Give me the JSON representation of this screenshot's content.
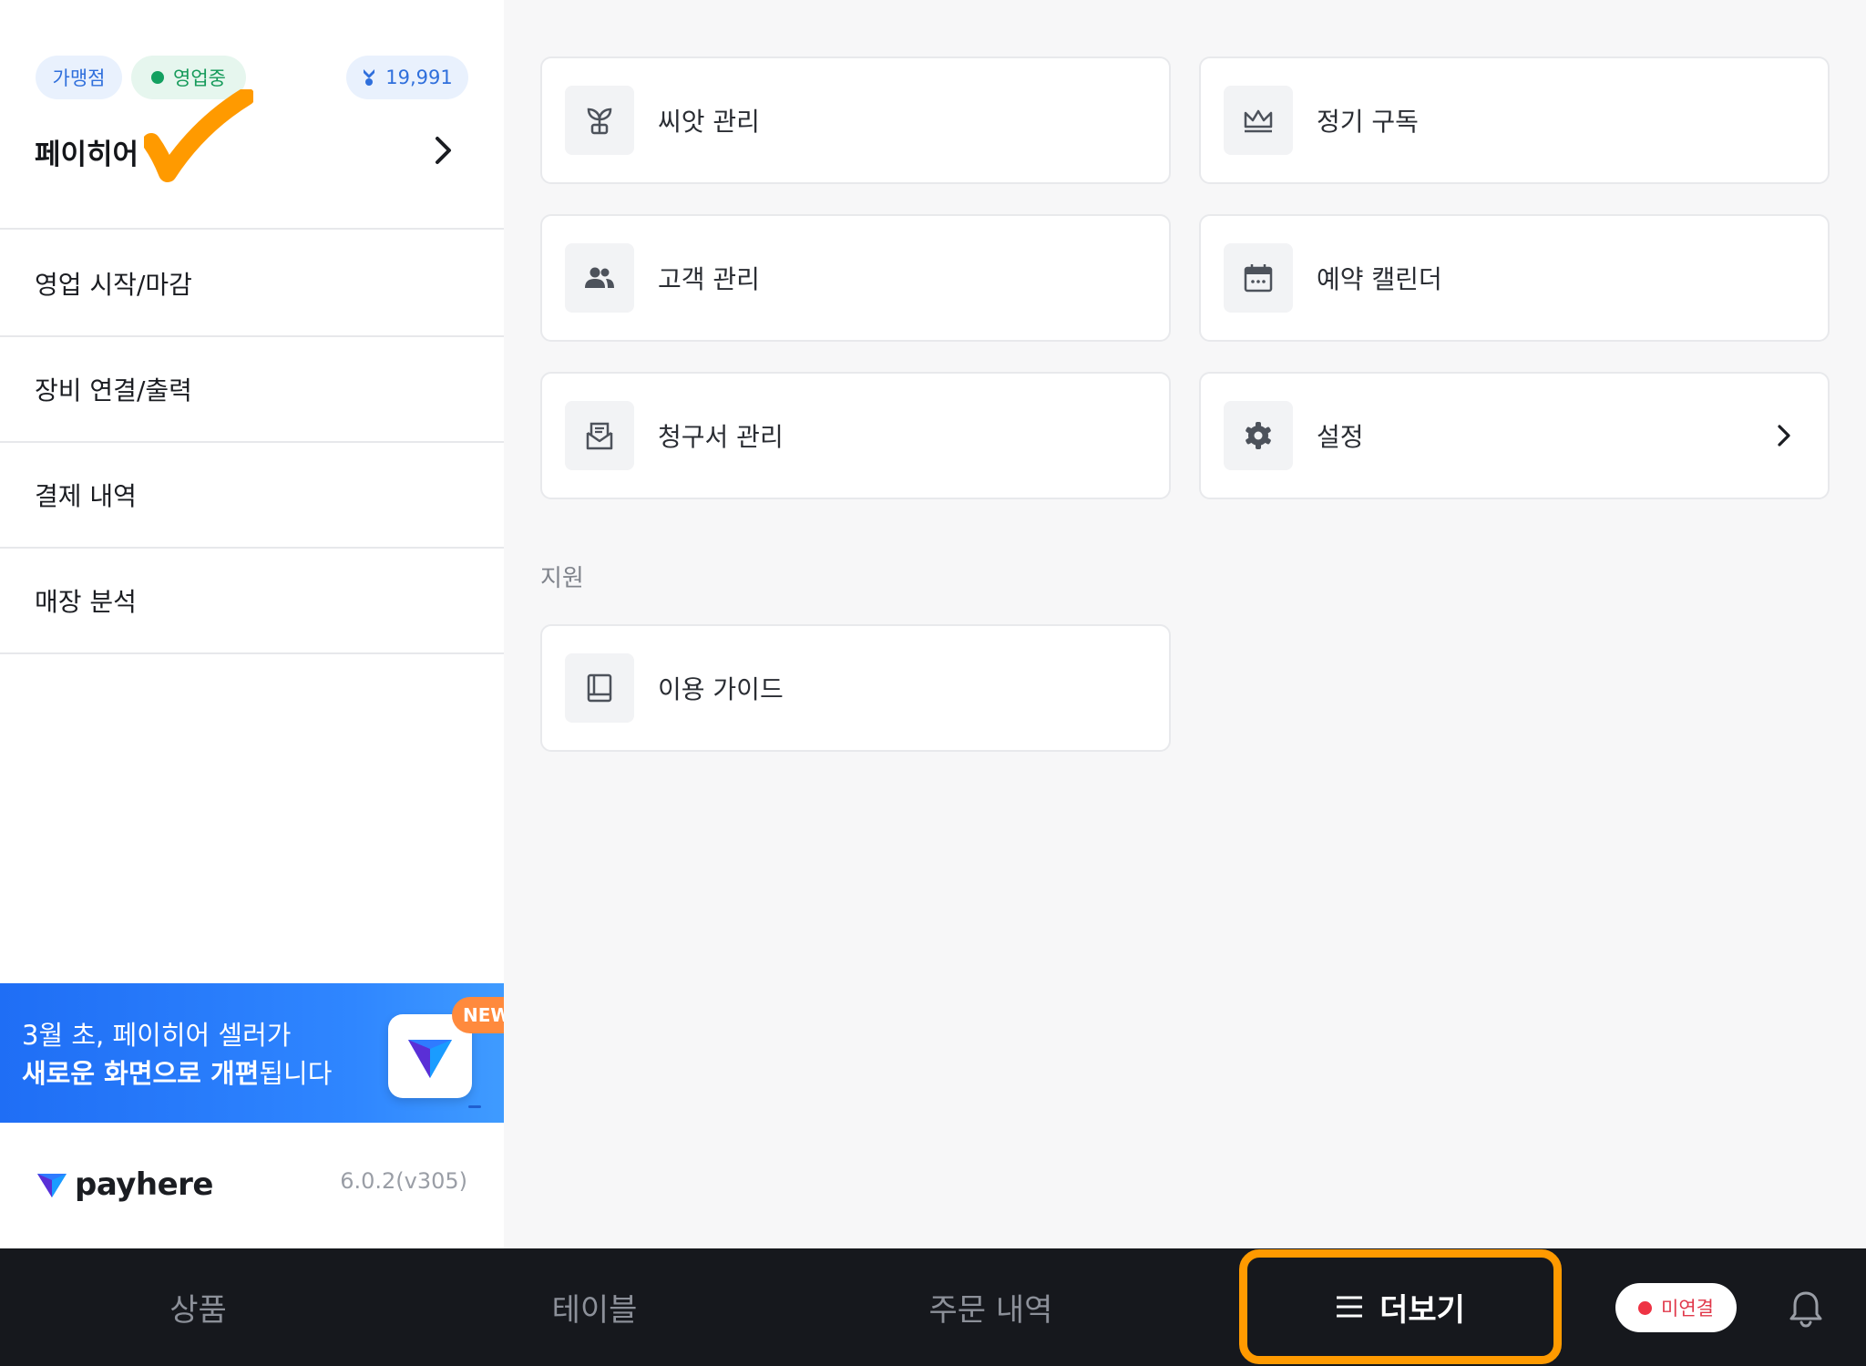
{
  "sidebar": {
    "badges": {
      "store_type": "가맹점",
      "status": "영업중",
      "seed_count": "19,991"
    },
    "store_name": "페이히어",
    "menu": [
      {
        "label": "영업 시작/마감"
      },
      {
        "label": "장비 연결/출력"
      },
      {
        "label": "결제 내역"
      },
      {
        "label": "매장 분석"
      }
    ],
    "banner": {
      "line1": "3월 초, 페이히어 셀러가",
      "line2_bold": "새로운 화면으로 개편",
      "line2_rest": "됩니다",
      "new_tag": "NEW"
    },
    "logo_text": "payhere",
    "version": "6.0.2(v305)"
  },
  "main": {
    "cards": [
      {
        "label": "씨앗 관리",
        "icon": "sprout-icon"
      },
      {
        "label": "정기 구독",
        "icon": "crown-icon"
      },
      {
        "label": "고객 관리",
        "icon": "people-icon"
      },
      {
        "label": "예약 캘린더",
        "icon": "calendar-icon"
      },
      {
        "label": "청구서 관리",
        "icon": "invoice-icon"
      },
      {
        "label": "설정",
        "icon": "gear-icon"
      }
    ],
    "support_title": "지원",
    "support_cards": [
      {
        "label": "이용 가이드",
        "icon": "book-icon"
      }
    ]
  },
  "bottom_nav": {
    "items": [
      {
        "label": "상품"
      },
      {
        "label": "테이블"
      },
      {
        "label": "주문 내역"
      },
      {
        "label": "더보기"
      }
    ],
    "connection_status": "미연결"
  },
  "colors": {
    "accent_highlight": "#ff9a00",
    "brand_blue": "#2f86ff",
    "open_green": "#13a060",
    "disconnected_red": "#ee3344"
  }
}
